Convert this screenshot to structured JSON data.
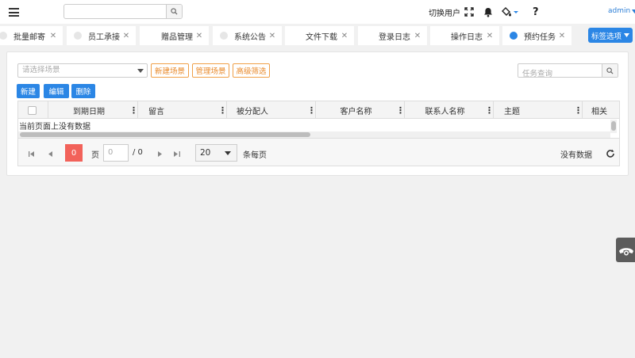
{
  "header": {
    "search_value": "",
    "switch_user_label": "切换用户",
    "user_name": "admin"
  },
  "tabs": [
    {
      "label": "批量邮寄",
      "active": false
    },
    {
      "label": "员工承接",
      "active": false
    },
    {
      "label": "赠品管理",
      "active": false
    },
    {
      "label": "系统公告",
      "active": false
    },
    {
      "label": "文件下载",
      "active": false
    },
    {
      "label": "登录日志",
      "active": false
    },
    {
      "label": "操作日志",
      "active": false
    },
    {
      "label": "预约任务",
      "active": true
    }
  ],
  "tab_options_label": "标签选项",
  "toolbar": {
    "scene_placeholder": "请选择场景",
    "new_scene_label": "新建场景",
    "manage_scene_label": "管理场景",
    "advanced_filter_label": "高级筛选",
    "task_search_placeholder": "任务查询",
    "new_label": "新建",
    "edit_label": "编辑",
    "delete_label": "删除"
  },
  "table": {
    "columns": [
      "到期日期",
      "留言",
      "被分配人",
      "客户名称",
      "联系人名称",
      "主题",
      "相关"
    ],
    "empty_text": "当前页面上没有数据"
  },
  "pager": {
    "current_page": "0",
    "page_label": "页",
    "page_input_value": "0",
    "total_pages_text": "/ 0",
    "page_size": "20",
    "per_page_label": "条每页",
    "status_text": "没有数据"
  },
  "colors": {
    "primary": "#2b86e5",
    "orange": "#e8892a",
    "current_page": "#f2625a"
  }
}
